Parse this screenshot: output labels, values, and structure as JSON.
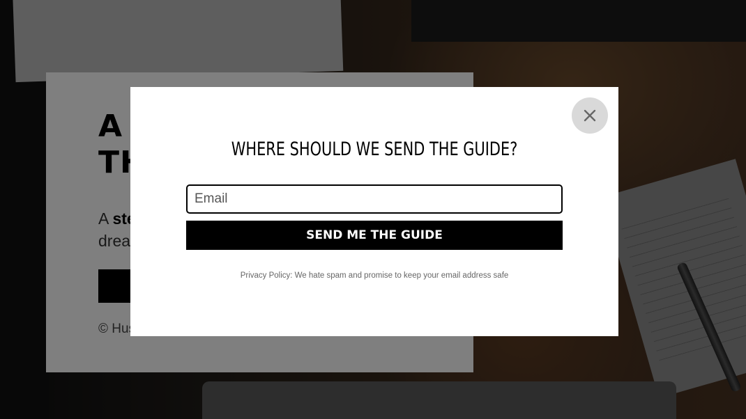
{
  "hero": {
    "title_line1": "A H",
    "title_line2": "TH",
    "subtitle_bold": "ste",
    "subtitle_prefix": "A ",
    "subtitle_line2": "drean",
    "copyright": "© Hustle Gal"
  },
  "modal": {
    "title": "WHERE SHOULD WE SEND THE GUIDE?",
    "email_placeholder": "Email",
    "email_value": "",
    "submit_label": "SEND ME THE GUIDE",
    "privacy_text": "Privacy Policy: We hate spam and promise to keep your email address safe",
    "close_icon": "close-icon"
  },
  "colors": {
    "overlay": "#000000",
    "button": "#000000",
    "close_bg": "#d9d9d9"
  }
}
